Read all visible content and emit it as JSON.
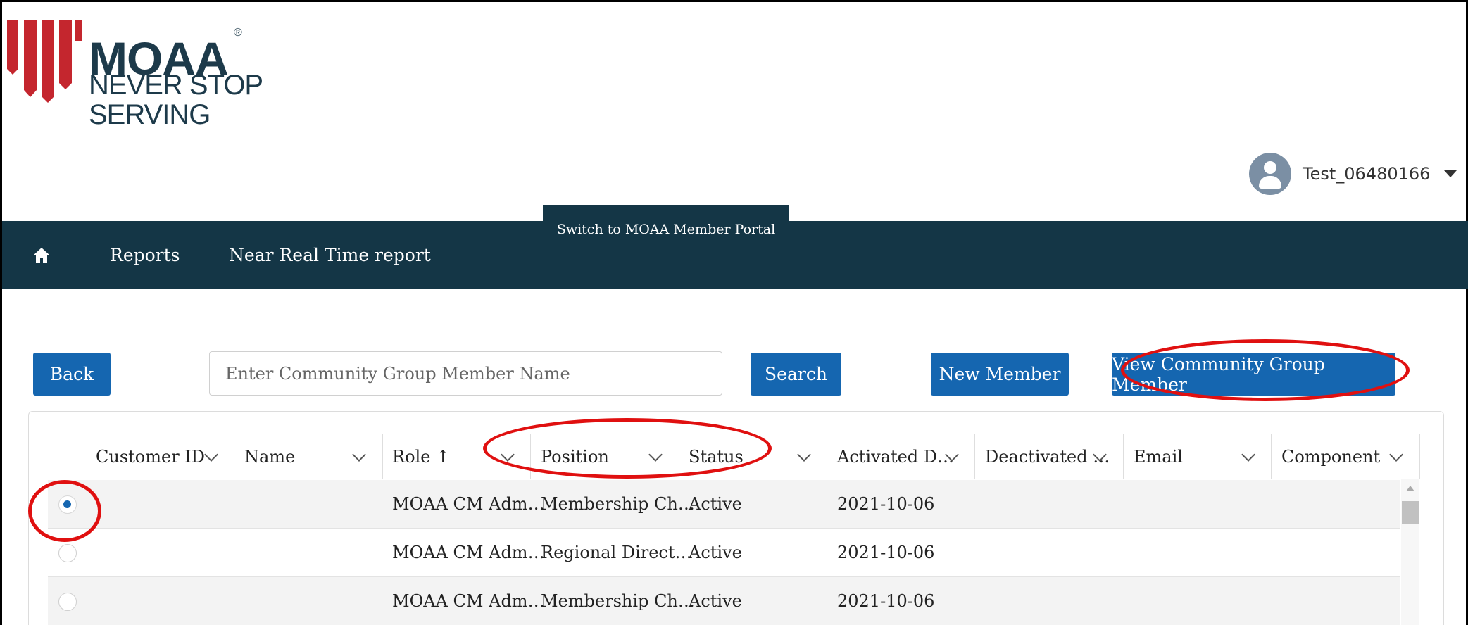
{
  "brand": {
    "name": "MOAA",
    "registered_mark": "®",
    "tagline": "NEVER STOP SERVING",
    "colors": {
      "red": "#c4262e",
      "navy": "#1d3a4a"
    }
  },
  "user": {
    "name": "Test_06480166",
    "avatar_icon": "user-avatar-icon",
    "menu_icon": "caret-down-icon"
  },
  "nav": {
    "switch_label": "Switch to MOAA Member Portal",
    "home_icon": "home-icon",
    "items": [
      {
        "label": "Reports"
      },
      {
        "label": "Near Real Time report"
      }
    ],
    "background": "#143646"
  },
  "toolbar": {
    "back_label": "Back",
    "search": {
      "placeholder": "Enter Community Group Member Name",
      "value": ""
    },
    "search_label": "Search",
    "new_member_label": "New Member",
    "view_member_label": "View Community Group Member",
    "button_color": "#1566b0"
  },
  "table": {
    "columns": [
      {
        "label": "Customer ID",
        "sort": ""
      },
      {
        "label": "Name",
        "sort": ""
      },
      {
        "label": "Role ↑",
        "sort": "ascending"
      },
      {
        "label": "Position",
        "sort": ""
      },
      {
        "label": "Status",
        "sort": ""
      },
      {
        "label": "Activated D…",
        "sort": ""
      },
      {
        "label": "Deactivated …",
        "sort": ""
      },
      {
        "label": "Email",
        "sort": ""
      },
      {
        "label": "Component",
        "sort": ""
      }
    ],
    "rows": [
      {
        "selected": true,
        "customer_id": "",
        "name": "",
        "role": "MOAA CM Adm…",
        "position": "Membership Ch…",
        "status": "Active",
        "activated": "2021-10-06",
        "deactivated": "",
        "email": "",
        "component": ""
      },
      {
        "selected": false,
        "customer_id": "",
        "name": "",
        "role": "MOAA CM Adm…",
        "position": "Regional Direct…",
        "status": "Active",
        "activated": "2021-10-06",
        "deactivated": "",
        "email": "",
        "component": ""
      },
      {
        "selected": false,
        "customer_id": "",
        "name": "",
        "role": "MOAA CM Adm…",
        "position": "Membership Ch…",
        "status": "Active",
        "activated": "2021-10-06",
        "deactivated": "",
        "email": "",
        "component": ""
      }
    ]
  },
  "annotations": {
    "color": "#e01010",
    "shape": "ellipse"
  }
}
